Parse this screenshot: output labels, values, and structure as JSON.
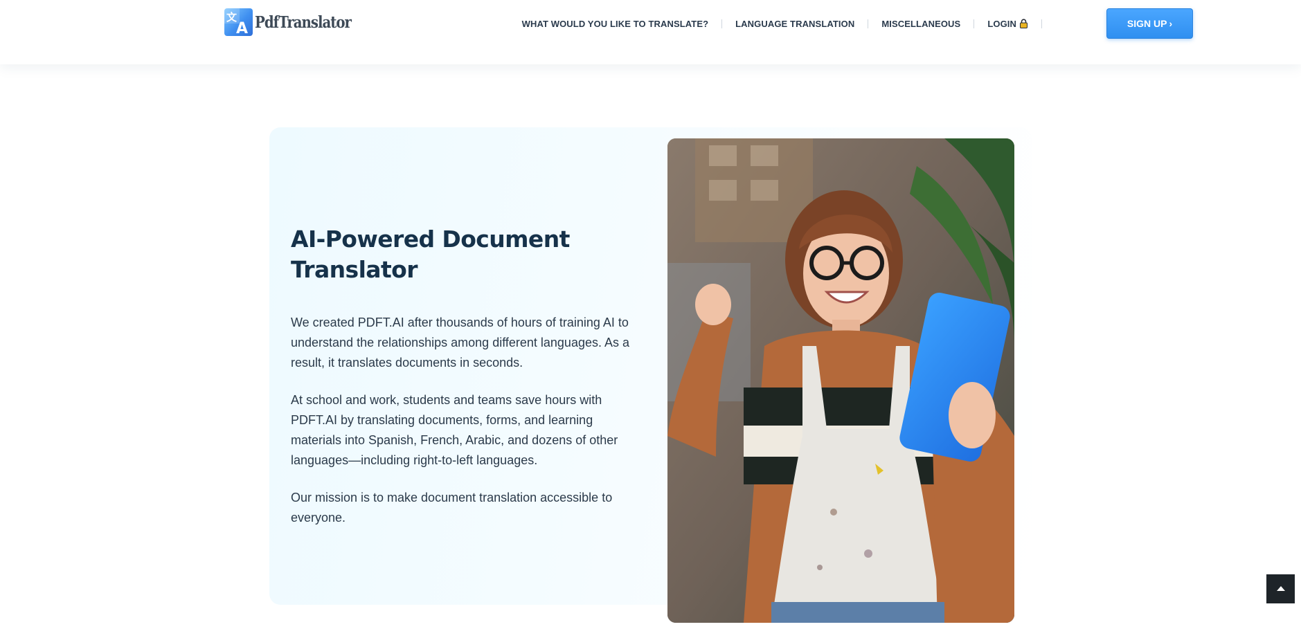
{
  "header": {
    "logo_text": "PdfTranslator",
    "nav": [
      {
        "label": "WHAT WOULD YOU LIKE TO TRANSLATE?"
      },
      {
        "label": "LANGUAGE TRANSLATION"
      },
      {
        "label": "MISCELLANEOUS"
      },
      {
        "label": "LOGIN"
      }
    ],
    "signup_label": "SIGN UP",
    "signup_chevron": "›"
  },
  "hero": {
    "title": "AI-Powered Document Translator",
    "paragraphs": [
      "We created PDFT.AI after thousands of hours of training AI to understand the relationships among different languages. As a result, it translates documents in seconds.",
      "At school and work, students and teams save hours with PDFT.AI by translating documents, forms, and learning materials into Spanish, French, Arabic, and dozens of other languages—including right-to-left languages.",
      "Our mission is to make document translation accessible to everyone."
    ],
    "photo_icon": "woman-with-tablet-photo"
  },
  "colors": {
    "accent": "#2f8ff0",
    "heading": "#16324a",
    "body_text": "#2b3a4a",
    "card_bg": "#eefaff",
    "scroll_button": "#1e2429"
  },
  "icons": {
    "logo": "translate-logo-icon",
    "login": "lock-icon",
    "scroll_top": "chevron-up-icon"
  }
}
